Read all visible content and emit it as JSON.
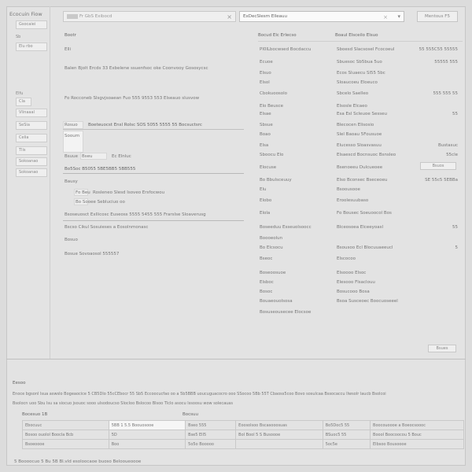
{
  "sidebar": {
    "title": "Ecocuin Fiow",
    "items": [
      {
        "label": "Gsocaiei"
      },
      {
        "label": "Sb"
      },
      {
        "label": "Elu rbo"
      },
      {
        "label": "Elfu"
      },
      {
        "label": "Cla"
      },
      {
        "label": "Vlinaaal"
      },
      {
        "label": "SeSia"
      },
      {
        "label": "Celia"
      },
      {
        "label": "Tlis"
      },
      {
        "label": "Sokoanao"
      }
    ]
  },
  "search": {
    "value": "Fr GbS Exibocd"
  },
  "address": {
    "value": "ExDecSlesm Elleauu"
  },
  "top_button": {
    "label": "Mentous F5"
  },
  "left_block": {
    "lines": [
      "Bootr",
      "Elli",
      "Balen Bjolt Ercds 33 Exbelene ssuenfsoc oke Coonvooy Gososycsc",
      "Fo Rocconeb Slsgvjsoaean Fuo 555 9553 553 Elseauo slusvow",
      "Rosuo",
      "Boeteuocst Ensl Rolsc SOS 5055 5555 55 Bocsuctsrc",
      "Sooum",
      "Bsuue",
      "Bseu",
      "Ec Elnluc",
      "Bo5Soc B5055 5BE5BB5 5BB555",
      "Bausy",
      "Fo Beu",
      "Rosleneo Slesd Isoveo Ersfocwou",
      "Bo Sooee Sebluciuo oo",
      "Bsoseuosct Exllicosc Euseoss 5555 5455 555 Frarslse Sloaverusg",
      "Bscso Cikul Sosuieses a Eosolnmonasc",
      "Bosuo",
      "Bosue Sovoaosol 555557"
    ]
  },
  "right_block": {
    "header": [
      "Bocud Elc Erlecso",
      "Boaul Elsceilo Elsuo"
    ],
    "rows": [
      {
        "label": "Pl0lLbocwsed Bocdaccu",
        "value": "Sboesd Slacsosel Fcocoeul",
        "aux": "55 555C55 55555"
      },
      {
        "label": "Ecuoe",
        "value": "Sbuesoc Sb5bua 5uo",
        "aux": "55555 555"
      },
      {
        "label": "Elsuo",
        "value": "Ecos Sluaecu Sl55 5bc",
        "aux": ""
      },
      {
        "label": "Elsol",
        "value": "Sloaucoeu Eloeuco",
        "aux": ""
      },
      {
        "label": "Cbokuoosolo",
        "value": "Sbcelo Saelleo",
        "aux": "555 555 55"
      },
      {
        "label": "Elo Beusce",
        "value": "Elsosle Elcaeo",
        "aux": ""
      },
      {
        "label": "Elsae",
        "value": "Esa Esl Scleuoe Sesseu",
        "aux": "55"
      },
      {
        "label": "Sbsue",
        "value": "Blecocen Elisosio",
        "aux": ""
      },
      {
        "label": "Boao",
        "value": "Slel Baoau 5Fousuoe",
        "aux": ""
      },
      {
        "label": "Elsa",
        "value": "Elucesso Sloasvasuu",
        "aux": "Bustasuc"
      },
      {
        "label": "Sboocu Elo",
        "value": "Elsaescd Bocnsuoc Bsnsleo",
        "aux": "55cle"
      },
      {
        "label": "Elocuse",
        "value": "Bsenoeeu Dulcueoee",
        "aux": ""
      },
      {
        "label": "Bo Bbulsceuuy",
        "value": "Elso Bconsec Bseceoeu",
        "aux": "SE 55c5 5EBBa"
      },
      {
        "label": "Elu",
        "value": "Bsoousooe",
        "aux": ""
      },
      {
        "label": "Elobo",
        "value": "Eroolesuubaso",
        "aux": ""
      },
      {
        "label": "Elola",
        "value": "Fo Bousec Soeuoocol Bos",
        "aux": ""
      },
      {
        "label": "Boseeduu Esseuolsoocc",
        "value": "Blceosoea Elceeyoasl",
        "aux": "55"
      },
      {
        "label": "Boooeolun",
        "value": "",
        "aux": ""
      },
      {
        "label": "Bo Elcsocu",
        "value": "Bsousoo Ecl Blocuuaeeucl",
        "aux": "5"
      },
      {
        "label": "Bseoc",
        "value": "Elscocoo",
        "aux": ""
      },
      {
        "label": "Boseoosuoe",
        "value": "Elsoooo Elsoc",
        "aux": ""
      },
      {
        "label": "Elsboc",
        "value": "Elesooo Flsaclouu",
        "aux": ""
      },
      {
        "label": "Bosoc",
        "value": "Bosucooo Bosa",
        "aux": ""
      },
      {
        "label": "Bouaeouolsosa",
        "value": "Bsoa Susceoec Boocuoseeel",
        "aux": ""
      },
      {
        "label": "Bosuseousecee Elocsoe",
        "value": "",
        "aux": ""
      }
    ],
    "side_button": "Bsuos",
    "bottom_button": "Bsues"
  },
  "bottom": {
    "title": "Eesoo",
    "para1": "Enoce bgsonl lsua aswslo Bogeaocice 5 CB5Dlo 55cCEbocr 55 Sb5 Eccoocucfao oo a 5b5BBB uoucuguacocro ooo SSocoo 5Bb 55T Cbaoss5coo Bovo sosulcaa Bssocaccu Ilwsolr laucb Bsolcoi",
    "para2": "Bsolocn uoo Sbu lsu sa siocuo jsouoc sooo ulsodoucso Slocloo Bslocoo Blsoo Tlclo asocu lssoosu wow solecauas",
    "col1": "Bocesuo 1B",
    "col2": "Bocsuu",
    "grid": [
      [
        "Ebocuuc",
        "5BB 1 5.5 Boouosooe",
        "Bseo 555",
        "Eoosolsoo Bscasooosuas",
        "Bo5Doc5 55",
        "Boocouoooe a Boeocsoooc"
      ],
      [
        "Bosoo ouolol Boocla Bcb",
        "5D",
        "Bse5 Ell5",
        "Bol Bool 5 S Busoooe",
        "BSuoc5 55",
        "Boool Boocoocou 5 Bouc"
      ],
      [
        "Bsoeoooe",
        "Boo",
        "5o5o Booooo",
        "",
        "5oc5e",
        "Elbsoo Bousoooe"
      ]
    ],
    "footnote": "5 Boooocuo 5 Bu 5B Bl.vld esoloocaoe buoso Belooueoooe"
  }
}
